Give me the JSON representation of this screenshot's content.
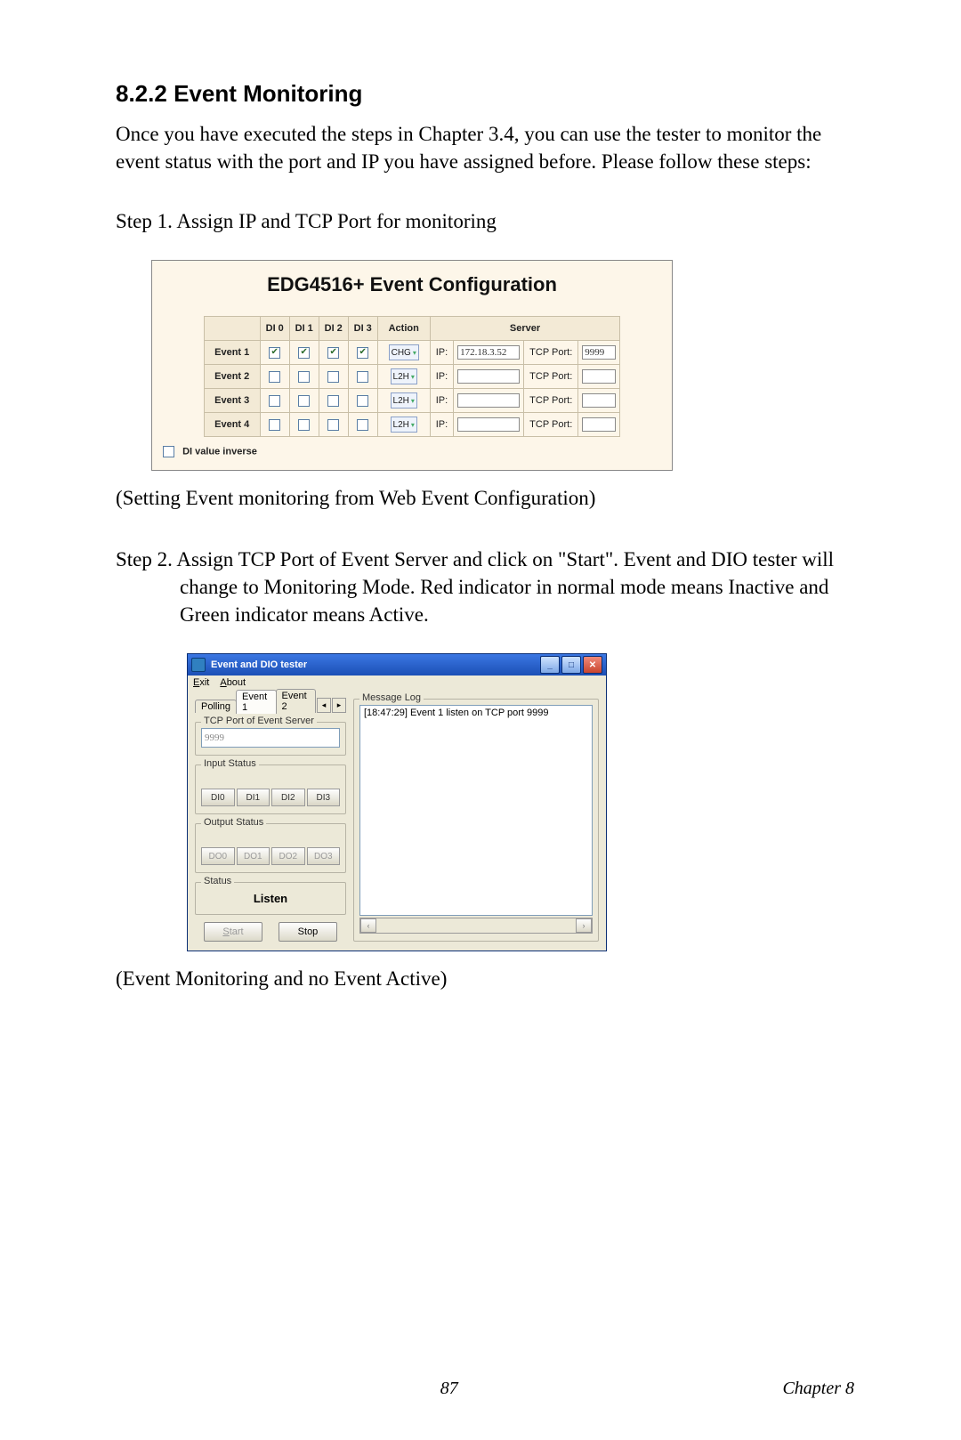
{
  "section": {
    "number": "8.2.2",
    "title": "Event Monitoring"
  },
  "intro": "Once you have executed the steps in Chapter 3.4, you can use the tester to monitor the event status with the port and IP you have assigned before. Please follow these steps:",
  "step1": "Step 1. Assign IP and TCP Port for monitoring",
  "fig1": {
    "title": "EDG4516+ Event Configuration",
    "di_headers": [
      "DI 0",
      "DI 1",
      "DI 2",
      "DI 3"
    ],
    "action_header": "Action",
    "server_header": "Server",
    "ip_label": "IP:",
    "port_label": "TCP Port:",
    "rows": [
      {
        "label": "Event 1",
        "di": [
          true,
          true,
          true,
          true
        ],
        "action": "CHG",
        "ip": "172.18.3.52",
        "port": "9999"
      },
      {
        "label": "Event 2",
        "di": [
          false,
          false,
          false,
          false
        ],
        "action": "L2H",
        "ip": "",
        "port": ""
      },
      {
        "label": "Event 3",
        "di": [
          false,
          false,
          false,
          false
        ],
        "action": "L2H",
        "ip": "",
        "port": ""
      },
      {
        "label": "Event 4",
        "di": [
          false,
          false,
          false,
          false
        ],
        "action": "L2H",
        "ip": "",
        "port": ""
      }
    ],
    "di_inverse_label": "DI value inverse"
  },
  "caption1": "(Setting Event monitoring from Web Event Configuration)",
  "step2": "Step 2. Assign TCP Port of Event Server and click on \"Start\". Event and DIO tester will change to Monitoring Mode. Red indicator in normal mode means Inactive and Green indicator means Active.",
  "fig2": {
    "title": "Event and DIO tester",
    "menu": {
      "exit": "Exit",
      "about": "About"
    },
    "tabs": {
      "polling": "Polling",
      "event1": "Event 1",
      "event2": "Event 2"
    },
    "group_tcp": "TCP Port of Event Server",
    "tcp_value": "9999",
    "group_input": "Input Status",
    "di_labels": [
      "DI0",
      "DI1",
      "DI2",
      "DI3"
    ],
    "group_output": "Output Status",
    "do_labels": [
      "DO0",
      "DO1",
      "DO2",
      "DO3"
    ],
    "group_status": "Status",
    "status_value": "Listen",
    "start": "Start",
    "stop": "Stop",
    "group_log": "Message Log",
    "log_line": "[18:47:29] Event 1 listen on TCP port 9999"
  },
  "caption2": "(Event Monitoring and no Event Active)",
  "footer": {
    "page": "87",
    "chapter": "Chapter 8"
  }
}
